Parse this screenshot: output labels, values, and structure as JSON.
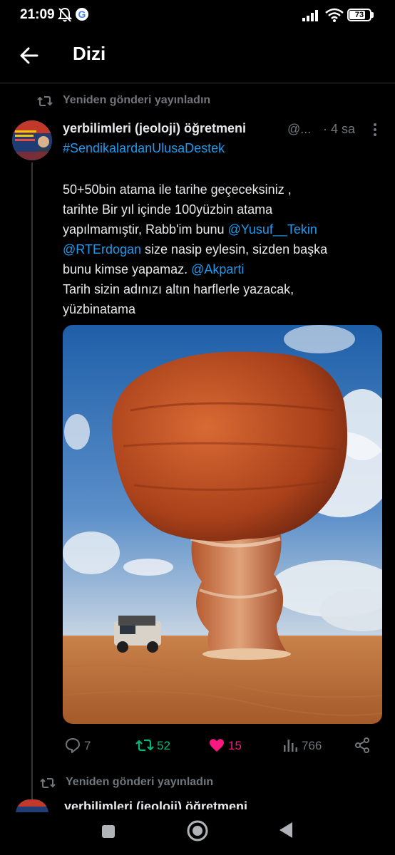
{
  "status_bar": {
    "time": "21:09",
    "battery": "73"
  },
  "header": {
    "title": "Dizi"
  },
  "repost_label": "Yeniden gönderi yayınladın",
  "post": {
    "author_name": "yerbilimleri (jeoloji) öğretmeni",
    "author_handle": "@...",
    "time": "· 4 sa",
    "hashtag": "#SendikalardanUlusaDestek",
    "text": {
      "l1": "50+50bin atama ile tarihe geçeceksiniz ,",
      "l2": "tarihte Bir yıl içinde 100yüzbin atama",
      "l3_a": "yapılmamıştir, Rabb'im bunu ",
      "l3_mention": "@Yusuf__Tekin",
      "l4_mention": "@RTErdogan",
      "l4_b": " size nasip eylesin, sizden başka",
      "l5_a": "bunu kimse yapamaz. ",
      "l5_mention": "@Akparti",
      "l6": "Tarih sizin adınızı altın harflerle yazacak,",
      "l7": "yüzbinatama"
    },
    "actions": {
      "replies": "7",
      "reposts": "52",
      "likes": "15",
      "views": "766"
    }
  },
  "next_item": {
    "repost_label": "Yeniden gönderi yayınladın",
    "author_name": "yerbilimleri (jeoloji) öğretmeni"
  },
  "colors": {
    "background": "#000000",
    "link": "#1d9bf0",
    "repost_active": "#00ba7c",
    "like_active": "#f91880",
    "muted": "#71767b"
  }
}
